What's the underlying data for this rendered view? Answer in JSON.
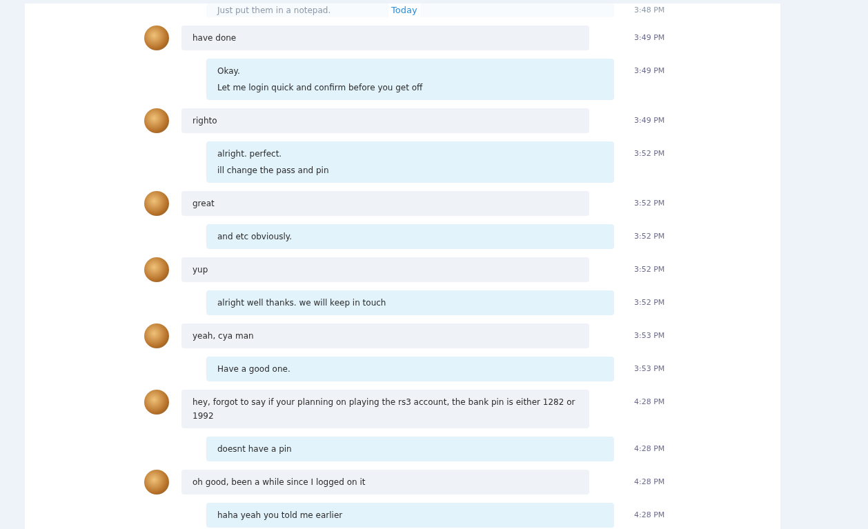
{
  "date_divider": "Today",
  "messages": [
    {
      "kind": "sent",
      "faded": true,
      "lines": [
        "Just put them in a notepad."
      ],
      "time": "3:48 PM"
    },
    {
      "kind": "received",
      "faded": false,
      "lines": [
        "have done"
      ],
      "time": "3:49 PM"
    },
    {
      "kind": "sent",
      "faded": false,
      "lines": [
        "Okay.",
        "Let me login quick and confirm before you get off"
      ],
      "time": "3:49 PM"
    },
    {
      "kind": "received",
      "faded": false,
      "lines": [
        "righto"
      ],
      "time": "3:49 PM"
    },
    {
      "kind": "sent",
      "faded": false,
      "lines": [
        "alright. perfect.",
        "ill change the pass and pin"
      ],
      "time": "3:52 PM"
    },
    {
      "kind": "received",
      "faded": false,
      "lines": [
        "great"
      ],
      "time": "3:52 PM"
    },
    {
      "kind": "sent",
      "faded": false,
      "lines": [
        "and etc obviously."
      ],
      "time": "3:52 PM"
    },
    {
      "kind": "received",
      "faded": false,
      "lines": [
        "yup"
      ],
      "time": "3:52 PM"
    },
    {
      "kind": "sent",
      "faded": false,
      "lines": [
        "alright well thanks. we will keep in touch"
      ],
      "time": "3:52 PM"
    },
    {
      "kind": "received",
      "faded": false,
      "lines": [
        "yeah, cya man"
      ],
      "time": "3:53 PM"
    },
    {
      "kind": "sent",
      "faded": false,
      "lines": [
        "Have a good one."
      ],
      "time": "3:53 PM"
    },
    {
      "kind": "received",
      "faded": false,
      "lines": [
        "hey, forgot to say if your planning on playing the rs3 account, the bank pin is either 1282 or 1992"
      ],
      "time": "4:28 PM"
    },
    {
      "kind": "sent",
      "faded": false,
      "lines": [
        "doesnt have a pin"
      ],
      "time": "4:28 PM"
    },
    {
      "kind": "received",
      "faded": false,
      "lines": [
        "oh good, been a while since I logged on it"
      ],
      "time": "4:28 PM"
    },
    {
      "kind": "sent",
      "faded": false,
      "lines": [
        "haha yeah you told me earlier"
      ],
      "time": "4:28 PM"
    }
  ]
}
